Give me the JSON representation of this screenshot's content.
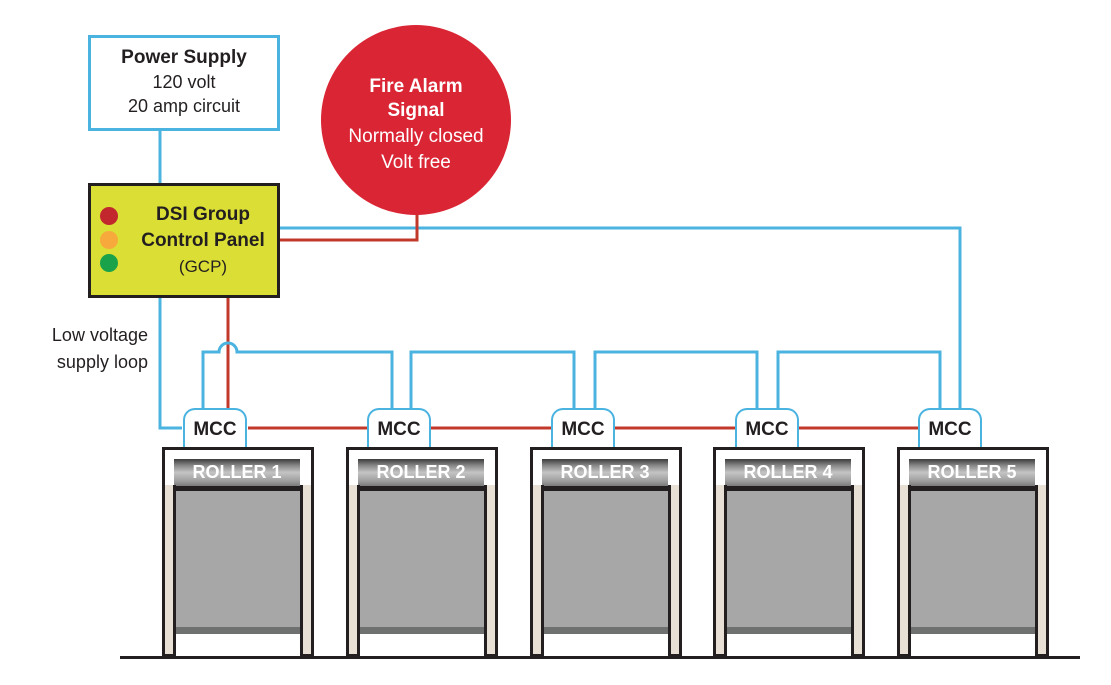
{
  "power_supply": {
    "title": "Power Supply",
    "line1": "120 volt",
    "line2": "20 amp circuit"
  },
  "fire_alarm": {
    "title_line1": "Fire Alarm",
    "title_line2": "Signal",
    "line1": "Normally closed",
    "line2": "Volt free",
    "color": "#d92534"
  },
  "control_panel": {
    "line1": "DSI Group",
    "line2": "Control Panel",
    "line3": "(GCP)",
    "background": "#dbdf35",
    "lights": [
      {
        "name": "red-indicator-light",
        "color": "#c1272d"
      },
      {
        "name": "amber-indicator-light",
        "color": "#f7a93b"
      },
      {
        "name": "green-indicator-light",
        "color": "#1aa24a"
      }
    ]
  },
  "loop_label": {
    "line1": "Low voltage",
    "line2": "supply loop"
  },
  "wire_colors": {
    "low_voltage": "#4ab3e0",
    "alarm_signal": "#c0392b"
  },
  "units": [
    {
      "mcc": "MCC",
      "roller": "ROLLER 1"
    },
    {
      "mcc": "MCC",
      "roller": "ROLLER 2"
    },
    {
      "mcc": "MCC",
      "roller": "ROLLER 3"
    },
    {
      "mcc": "MCC",
      "roller": "ROLLER 4"
    },
    {
      "mcc": "MCC",
      "roller": "ROLLER 5"
    }
  ]
}
